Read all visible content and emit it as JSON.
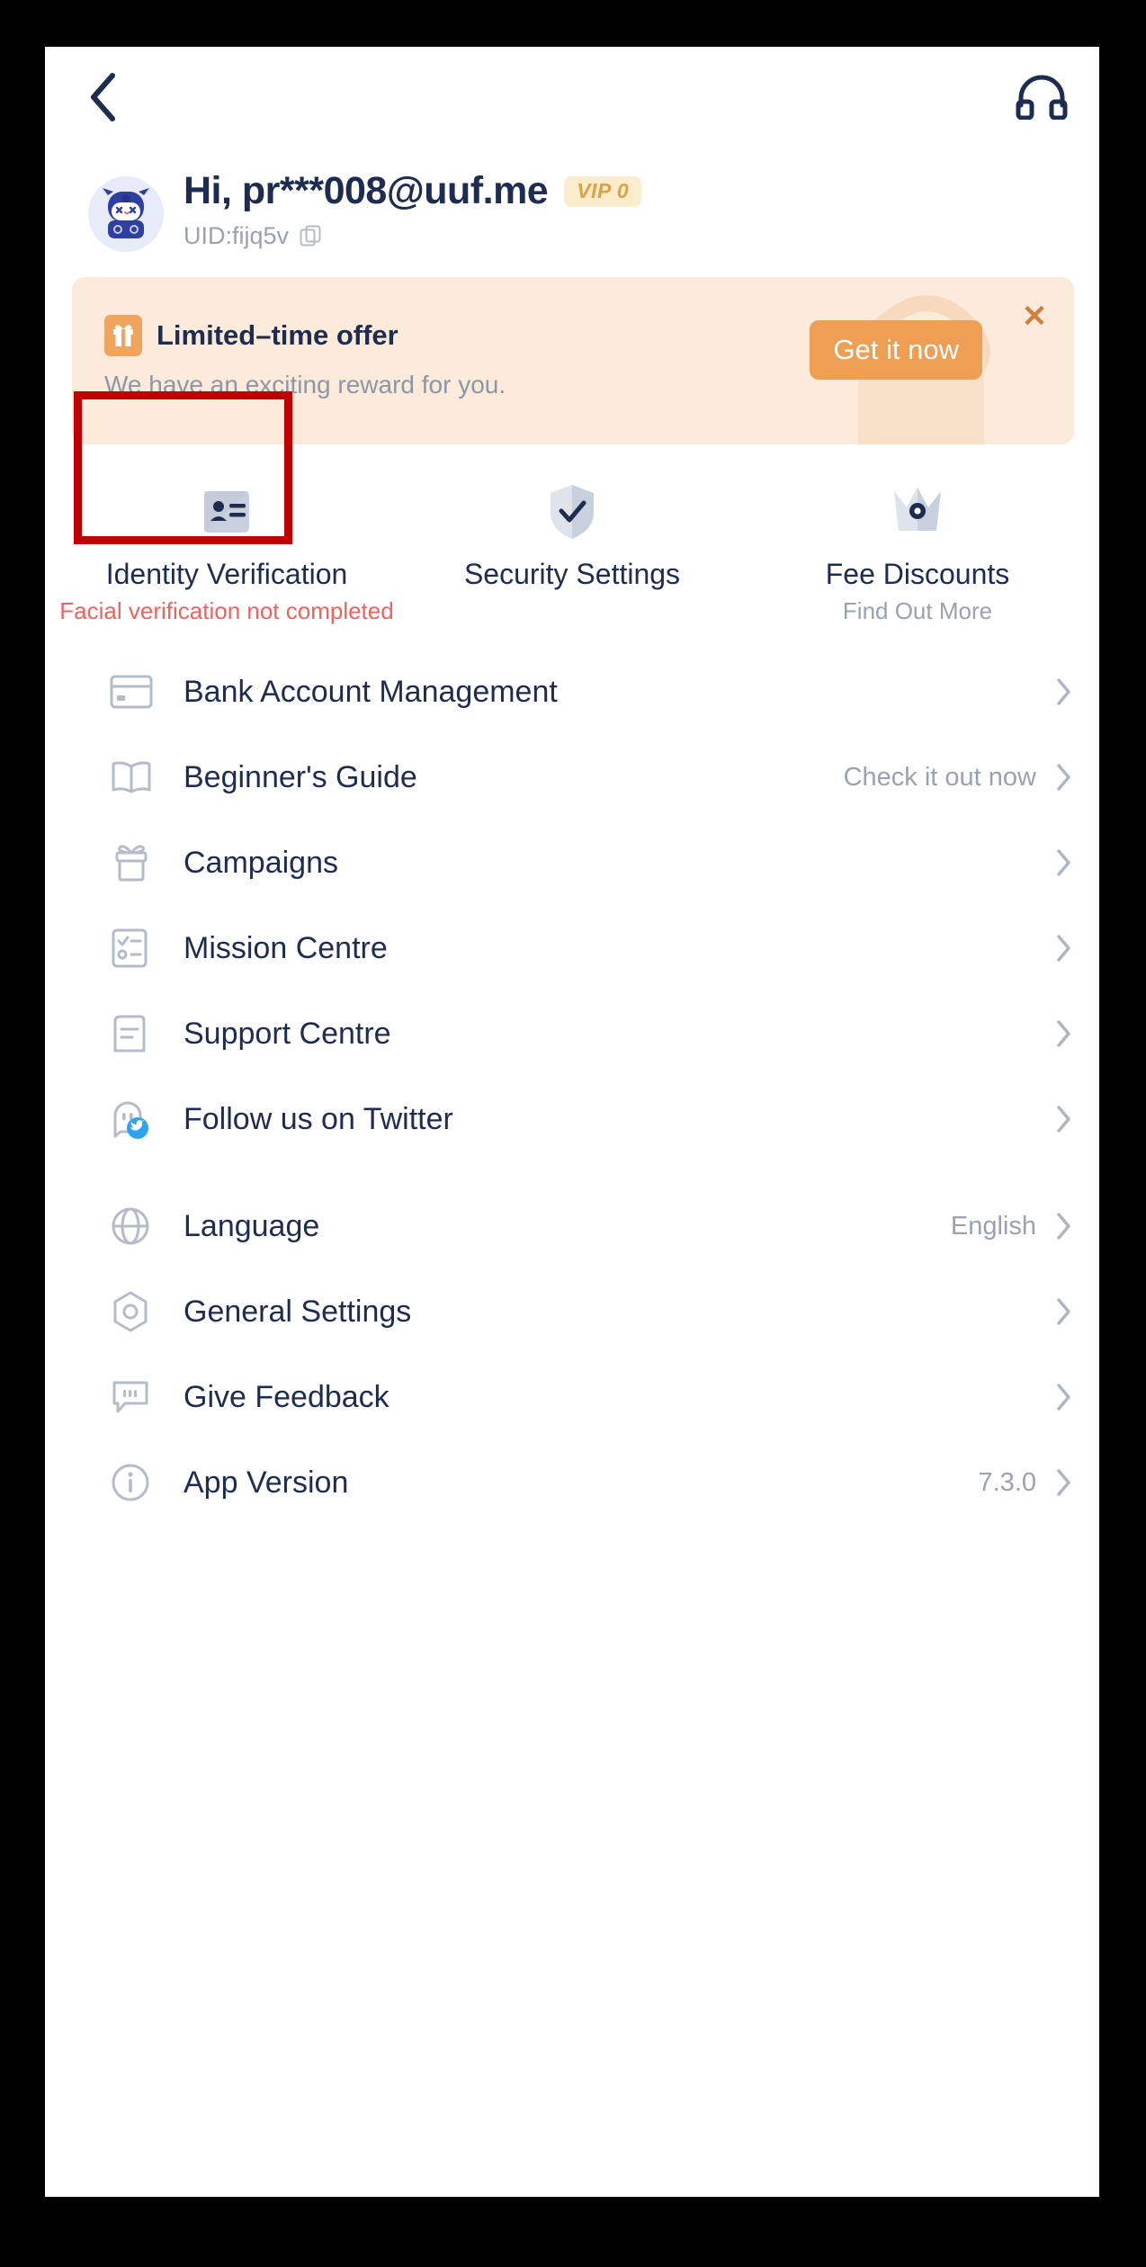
{
  "topbar": {
    "back_icon": "chevron-left-icon",
    "support_icon": "headset-icon"
  },
  "profile": {
    "avatar_icon": "mascot-avatar",
    "greeting": "Hi, pr***008@uuf.me",
    "vip_badge": "VIP 0",
    "uid": "UID:fijq5v",
    "copy_icon": "copy-icon"
  },
  "promo": {
    "icon": "gift-icon",
    "title": "Limited–time offer",
    "subtitle": "We have an exciting reward for you.",
    "cta_label": "Get it now",
    "close_icon": "close-icon",
    "bg_color": "#fceadb",
    "cta_color": "#ef9f54"
  },
  "tiles": [
    {
      "icon": "id-card-icon",
      "label": "Identity Verification",
      "sub": "Facial verification not completed",
      "sub_state": "warning",
      "sub_color": "#f0625f",
      "highlighted": true
    },
    {
      "icon": "shield-check-icon",
      "label": "Security Settings",
      "sub": "",
      "sub_state": "none",
      "highlighted": false
    },
    {
      "icon": "crown-icon",
      "label": "Fee Discounts",
      "sub": "Find Out More",
      "sub_state": "muted",
      "sub_color": "#9aa2b1",
      "highlighted": false
    }
  ],
  "menu": [
    {
      "icon": "card-icon",
      "label": "Bank Account Management",
      "value": ""
    },
    {
      "icon": "book-icon",
      "label": "Beginner's Guide",
      "value": "Check it out now"
    },
    {
      "icon": "gift-box-icon",
      "label": "Campaigns",
      "value": ""
    },
    {
      "icon": "checklist-icon",
      "label": "Mission Centre",
      "value": ""
    },
    {
      "icon": "document-icon",
      "label": "Support Centre",
      "value": ""
    },
    {
      "icon": "twitter-icon",
      "label": "Follow us on Twitter",
      "value": ""
    },
    {
      "icon": "globe-icon",
      "label": "Language",
      "value": "English"
    },
    {
      "icon": "hexagon-gear-icon",
      "label": "General Settings",
      "value": ""
    },
    {
      "icon": "feedback-icon",
      "label": "Give Feedback",
      "value": ""
    },
    {
      "icon": "info-icon",
      "label": "App Version",
      "value": "7.3.0"
    }
  ],
  "annotation": {
    "type": "highlight-box",
    "color": "#c00000",
    "target": "Identity Verification"
  }
}
